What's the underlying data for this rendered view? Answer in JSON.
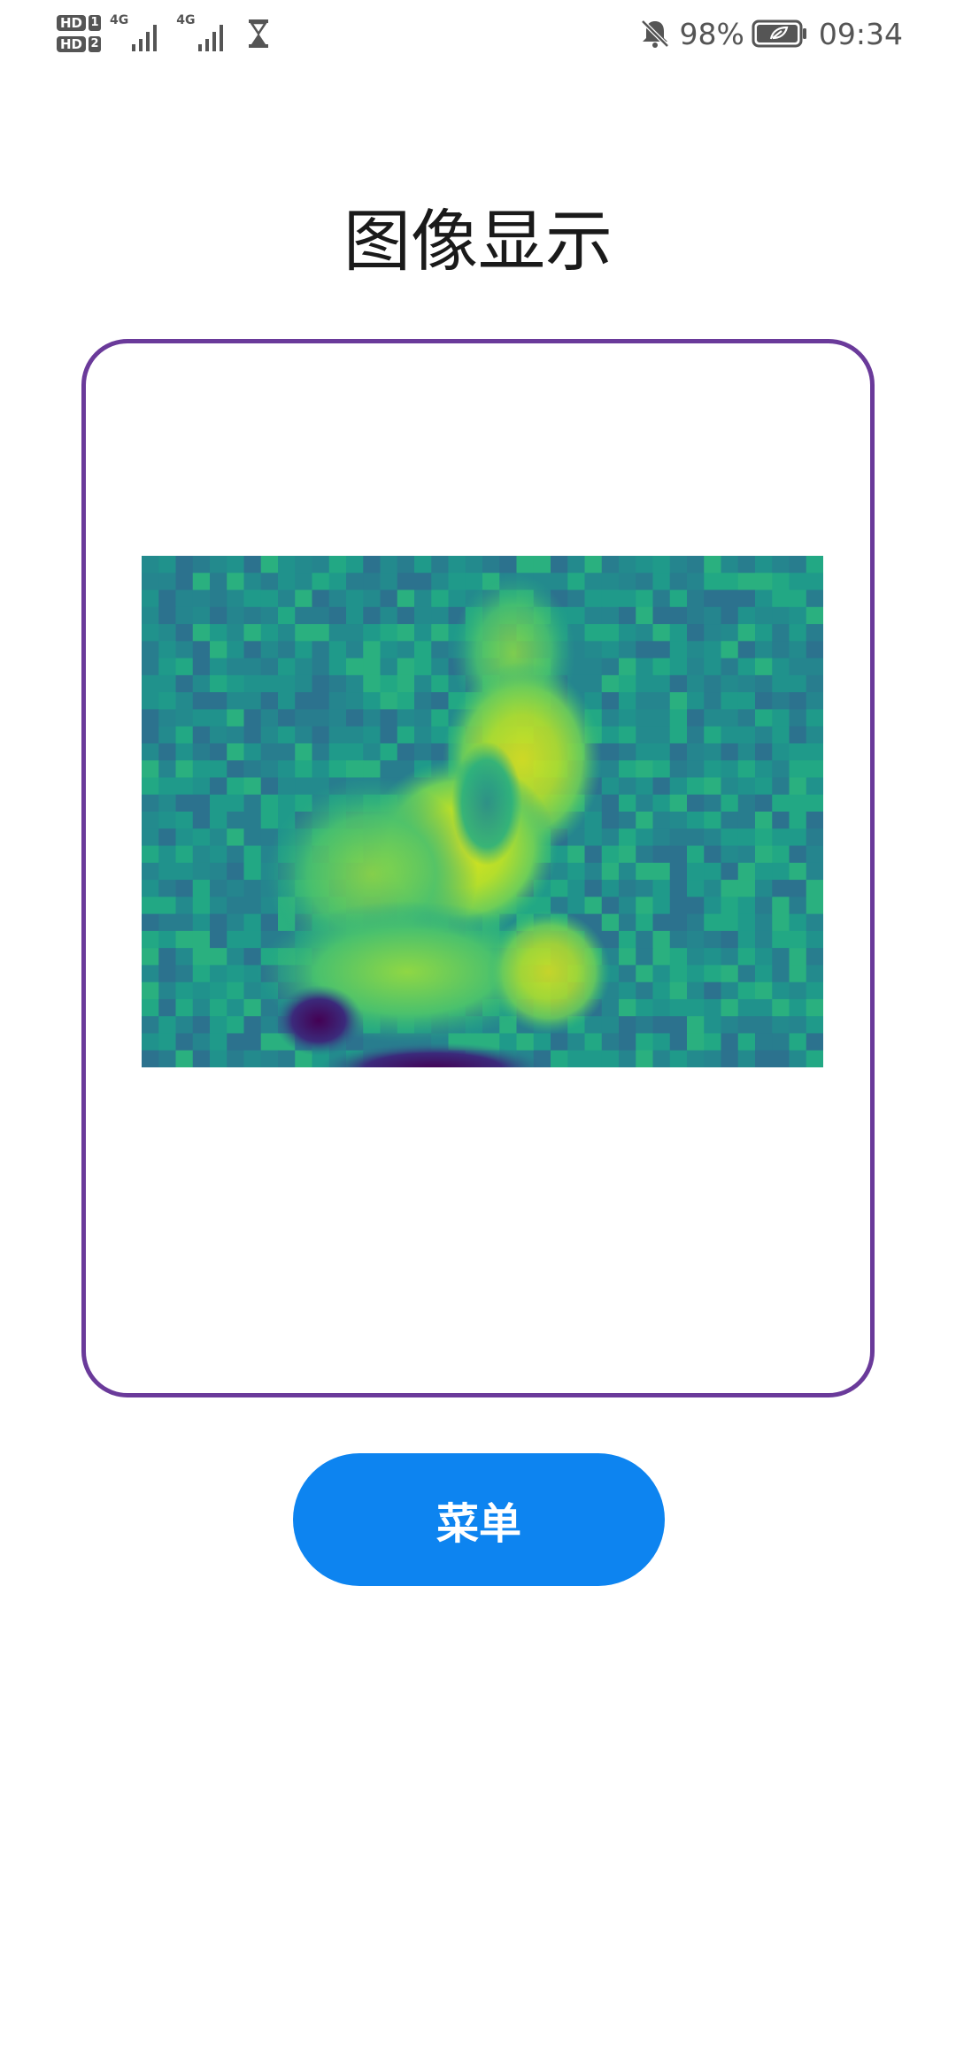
{
  "status_bar": {
    "sim1_badge": "HD",
    "sim1_index": "1",
    "sim2_badge": "HD",
    "sim2_index": "2",
    "network_type_1": "4G",
    "network_type_2": "4G",
    "battery_percent": "98%",
    "time": "09:34",
    "icons": [
      "signal-icon",
      "hourglass-icon",
      "bell-off-icon",
      "battery-icon"
    ]
  },
  "page": {
    "title": "图像显示"
  },
  "image": {
    "icon": "heatmap-image",
    "colormap": "viridis"
  },
  "menu": {
    "label": "菜单",
    "color": "#0d84f0"
  },
  "colors": {
    "frame_border": "#6a3a9a",
    "background": "#ffffff"
  }
}
